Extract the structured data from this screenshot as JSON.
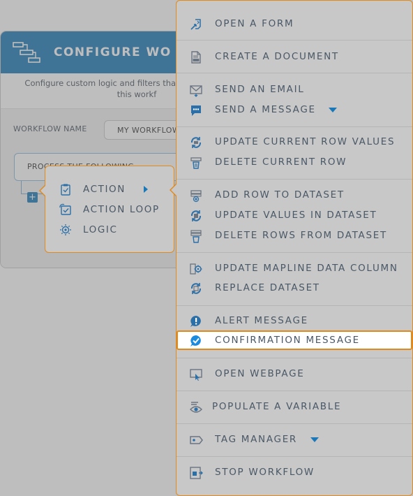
{
  "dialog": {
    "title": "CONFIGURE WO",
    "description_line1": "Configure custom logic and filters that",
    "description_line2": "this workf",
    "workflow_name_label": "WORKFLOW NAME",
    "workflow_name_value": "MY WORKFLOW",
    "process_text": "PROCESS THE FOLLOWING",
    "add_label": "+"
  },
  "popup": {
    "items": [
      {
        "label": "ACTION",
        "icon": "clipboard-check-icon"
      },
      {
        "label": "ACTION LOOP",
        "icon": "loop-check-icon"
      },
      {
        "label": "LOGIC",
        "icon": "logic-gear-icon"
      }
    ]
  },
  "menu": {
    "items": [
      {
        "label": "OPEN A FORM",
        "icon": "form-icon"
      },
      {
        "label": "CREATE A DOCUMENT",
        "icon": "pdf-document-icon"
      },
      {
        "label": "SEND AN EMAIL",
        "icon": "email-icon"
      },
      {
        "label": "SEND A MESSAGE",
        "icon": "chat-icon"
      },
      {
        "label": "UPDATE CURRENT ROW VALUES",
        "icon": "refresh-row-icon"
      },
      {
        "label": "DELETE CURRENT ROW",
        "icon": "delete-row-icon"
      },
      {
        "label": "ADD ROW TO DATASET",
        "icon": "add-row-icon"
      },
      {
        "label": "UPDATE VALUES IN DATASET",
        "icon": "refresh-dataset-icon"
      },
      {
        "label": "DELETE ROWS FROM DATASET",
        "icon": "delete-rows-icon"
      },
      {
        "label": "UPDATE MAPLINE DATA COLUMN",
        "icon": "column-gear-icon"
      },
      {
        "label": "REPLACE DATASET",
        "icon": "replace-dataset-icon"
      },
      {
        "label": "ALERT MESSAGE",
        "icon": "alert-icon"
      },
      {
        "label": "CONFIRMATION MESSAGE",
        "icon": "confirmation-icon"
      },
      {
        "label": "OPEN WEBPAGE",
        "icon": "webpage-icon"
      },
      {
        "label": "POPULATE A VARIABLE",
        "icon": "variable-eye-icon"
      },
      {
        "label": "TAG MANAGER",
        "icon": "tag-icon"
      },
      {
        "label": "STOP WORKFLOW",
        "icon": "stop-workflow-icon"
      }
    ],
    "highlighted_item": "CONFIRMATION MESSAGE"
  },
  "colors": {
    "accent_blue": "#1b78b8",
    "highlight_orange": "#e08a1e",
    "menu_gray": "#c8c8c8",
    "label_text": "#4a5866"
  }
}
